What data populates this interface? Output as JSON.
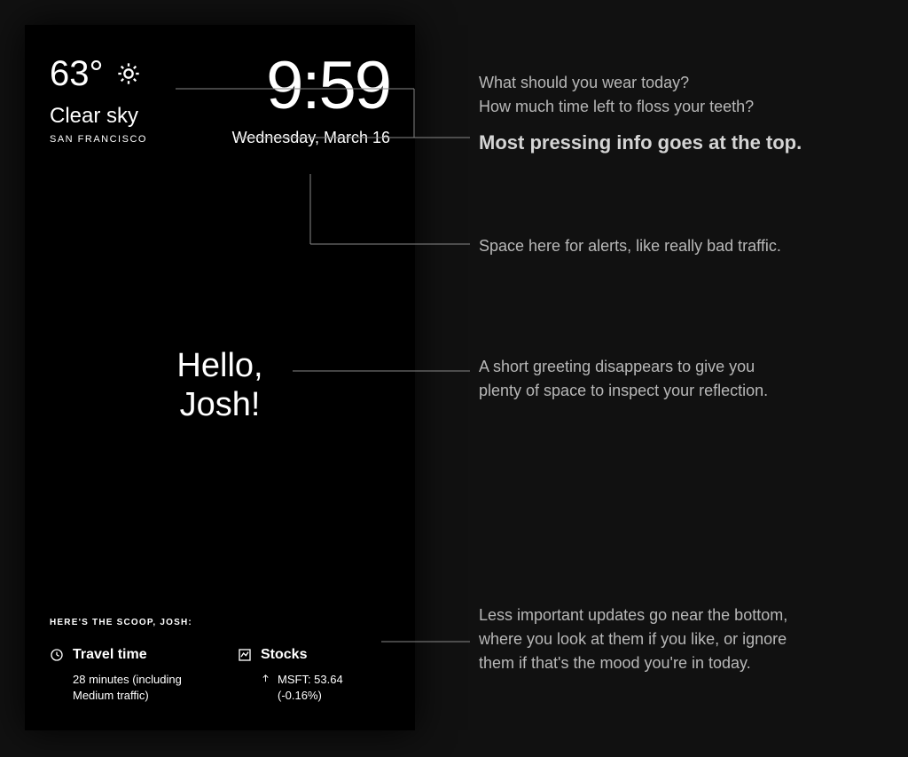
{
  "mirror": {
    "weather": {
      "temperature": "63°",
      "condition": "Clear sky",
      "location": "SAN FRANCISCO"
    },
    "clock": {
      "time": "9:59",
      "date": "Wednesday, March 16"
    },
    "greeting": {
      "line1": "Hello,",
      "line2": "Josh!"
    },
    "scoop_label": "HERE'S THE SCOOP, JOSH:",
    "widgets": {
      "travel": {
        "title": "Travel time",
        "detail": "28 minutes (including Medium traffic)"
      },
      "stocks": {
        "title": "Stocks",
        "detail": "MSFT: 53.64 (-0.16%)"
      }
    }
  },
  "annotations": {
    "a1_line1": "What should you wear today?",
    "a1_line2": "How much time left to floss your teeth?",
    "a1_bold": "Most pressing info goes at the top.",
    "a2": "Space here for alerts, like really bad traffic.",
    "a3_line1": "A short greeting disappears to give you",
    "a3_line2": "plenty of space to inspect your reflection.",
    "a4_line1": "Less important updates go near the bottom,",
    "a4_line2": "where you look at them if you like, or ignore",
    "a4_line3": "them if that's the mood you're in today."
  }
}
